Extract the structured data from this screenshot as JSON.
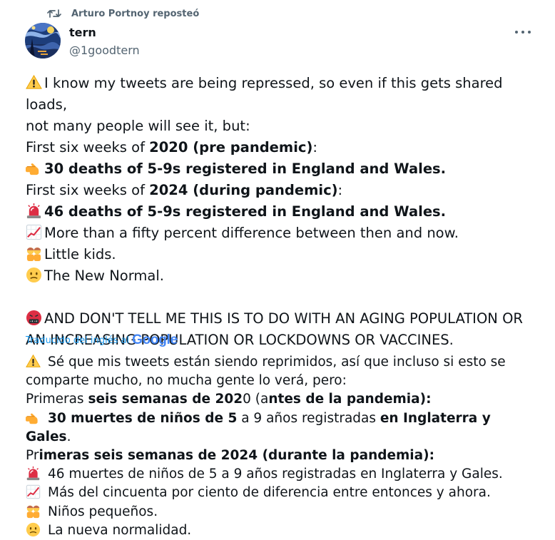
{
  "repost": {
    "text": "Arturo Portnoy reposteó"
  },
  "author": {
    "name": "tern",
    "handle": "@1goodtern"
  },
  "tweet": {
    "l1": "I know my tweets are being repressed, so even if this gets shared loads,",
    "l2": "not many people will see it, but:",
    "l3a": "First six weeks of ",
    "l3b": "2020 (pre pandemic)",
    "l3c": ":",
    "l4": "30 deaths of 5-9s registered in England and Wales.",
    "l5a": "First six weeks of ",
    "l5b": "2024 (during pandemic)",
    "l5c": ":",
    "l6": "46 deaths of 5-9s registered in England and Wales.",
    "l7": "More than a fifty percent difference between then and now.",
    "l8": "Little kids.",
    "l9": "The New Normal.",
    "l10": "AND DON'T TELL ME THIS IS TO DO WITH AN AGING POPULATION OR",
    "l11": "AN INCREASING POPULATION OR LOCKDOWNS OR VACCINES."
  },
  "translation": {
    "label": "Traducido del inglés al",
    "brand": "Google",
    "l1": "Sé que mis tweets están siendo reprimidos, así que incluso si esto se",
    "l2": "comparte mucho, no mucha gente lo verá, pero:",
    "l3a": "Primeras ",
    "l3b": "seis semanas de 202",
    "l3c": "0 (a",
    "l3d": "ntes de la pandemia):",
    "l4a": "30 muertes de niños de 5",
    "l4b": " a 9 años registradas ",
    "l4c": "en Inglaterra y Gales",
    "l4d": ".",
    "l5a": "Pr",
    "l5b": "imeras seis semanas de 2024 (durante la pandemia):",
    "l6": "46 muertes de niños de 5 a 9 años registradas en Inglaterra y Gales.",
    "l7": "Más del cincuenta por ciento de diferencia entre entonces y ahora.",
    "l8": "Niños pequeños.",
    "l9": "La nueva normalidad."
  },
  "icons": {
    "warning": "warning-icon",
    "point": "pointing-hand-icon",
    "siren": "siren-icon",
    "chart": "chart-increasing-icon",
    "kids": "kids-icon",
    "confused": "confused-face-icon",
    "angry": "cursing-face-icon",
    "repost": "repost-icon",
    "more": "more-icon"
  },
  "colors": {
    "link": "#1d9bf0",
    "secondary": "#536471",
    "text": "#0f1419"
  }
}
